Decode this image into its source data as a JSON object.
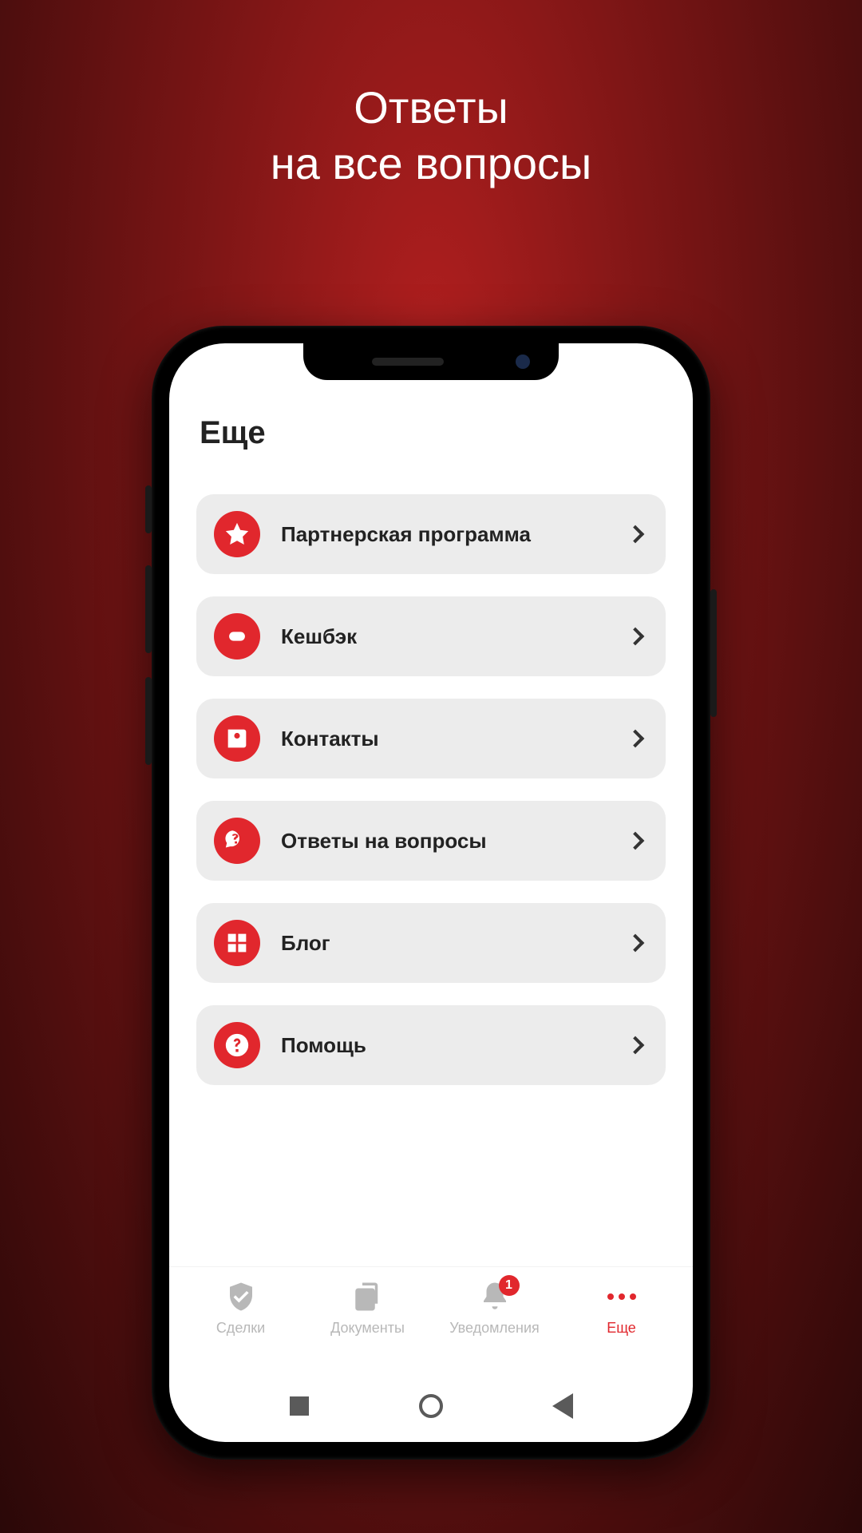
{
  "promo": {
    "line1": "Ответы",
    "line2": "на все вопросы"
  },
  "page": {
    "title": "Еще"
  },
  "menu": {
    "items": [
      {
        "icon": "star-icon",
        "label": "Партнерская программа"
      },
      {
        "icon": "cashback-icon",
        "label": "Кешбэк"
      },
      {
        "icon": "contacts-icon",
        "label": "Контакты"
      },
      {
        "icon": "faq-icon",
        "label": "Ответы на вопросы"
      },
      {
        "icon": "blog-icon",
        "label": "Блог"
      },
      {
        "icon": "help-icon",
        "label": "Помощь"
      }
    ]
  },
  "tabs": {
    "items": [
      {
        "name": "deals",
        "label": "Сделки",
        "icon": "shield-icon",
        "active": false,
        "badge": null
      },
      {
        "name": "documents",
        "label": "Документы",
        "icon": "docs-icon",
        "active": false,
        "badge": null
      },
      {
        "name": "notifications",
        "label": "Уведомления",
        "icon": "bell-icon",
        "active": false,
        "badge": "1"
      },
      {
        "name": "more",
        "label": "Еще",
        "icon": "more-icon",
        "active": true,
        "badge": null
      }
    ]
  },
  "colors": {
    "accent": "#e1272d"
  }
}
